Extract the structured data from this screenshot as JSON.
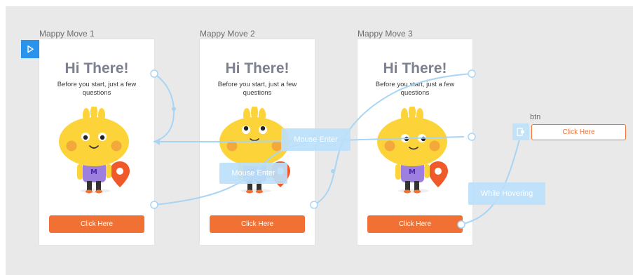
{
  "frames": [
    {
      "label": "Mappy Move 1",
      "title": "Hi There!",
      "subtitle": "Before you start, just a few questions",
      "button": "Click Here"
    },
    {
      "label": "Mappy Move 2",
      "title": "Hi There!",
      "subtitle": "Before you start, just a few questions",
      "button": "Click Here"
    },
    {
      "label": "Mappy Move 3",
      "title": "Hi There!",
      "subtitle": "Before you start, just a few questions",
      "button": "Click Here"
    }
  ],
  "triggers": {
    "mouse_enter_1": "Mouse Enter",
    "mouse_enter_2": "Mouse Enter",
    "while_hovering": "While Hovering"
  },
  "layer": {
    "name": "btn",
    "button": "Click Here"
  },
  "icons": {
    "play": "play-icon",
    "component": "component-icon",
    "location": "location-pin-icon"
  },
  "colors": {
    "accent": "#f07133",
    "wire": "#a9d5f5",
    "mascot": "#fdd33a",
    "shirt": "#9d7fe0",
    "pin": "#f0592a",
    "title": "#7c8090"
  }
}
